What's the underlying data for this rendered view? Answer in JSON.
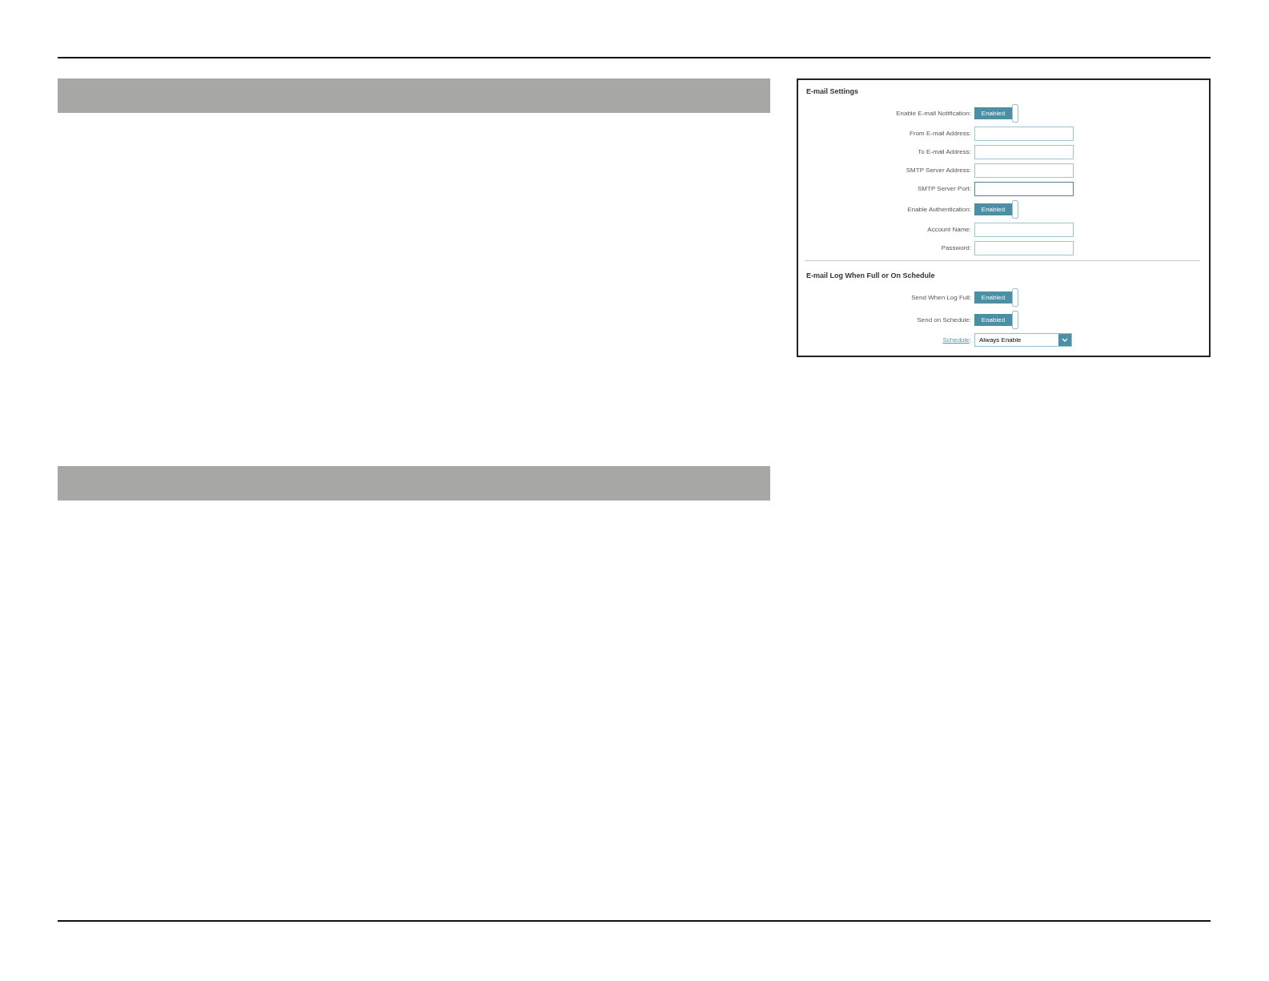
{
  "settings_panel": {
    "sections": [
      {
        "title": "E-mail Settings",
        "rows": [
          {
            "kind": "toggle",
            "label": "Enable E-mail Notification:",
            "value": "Enabled",
            "on": true
          },
          {
            "kind": "field",
            "label": "From E-mail Address:",
            "focused": false
          },
          {
            "kind": "field",
            "label": "To E-mail Address:",
            "focused": false
          },
          {
            "kind": "field",
            "label": "SMTP Server Address:",
            "focused": false
          },
          {
            "kind": "field",
            "label": "SMTP Server Port:",
            "focused": true
          },
          {
            "kind": "toggle",
            "label": "Enable Authentication:",
            "value": "Enabled",
            "on": true
          },
          {
            "kind": "field",
            "label": "Account Name:",
            "focused": false
          },
          {
            "kind": "field",
            "label": "Password:",
            "focused": false
          }
        ]
      },
      {
        "title": "E-mail Log When Full or On Schedule",
        "rows": [
          {
            "kind": "toggle",
            "label": "Send When Log Full:",
            "value": "Enabled",
            "on": true
          },
          {
            "kind": "toggle",
            "label": "Send on Schedule:",
            "value": "Enabled",
            "on": true
          },
          {
            "kind": "select",
            "label": "Schedule",
            "label_suffix": ":",
            "link": true,
            "value": "Always Enable"
          }
        ]
      }
    ]
  }
}
